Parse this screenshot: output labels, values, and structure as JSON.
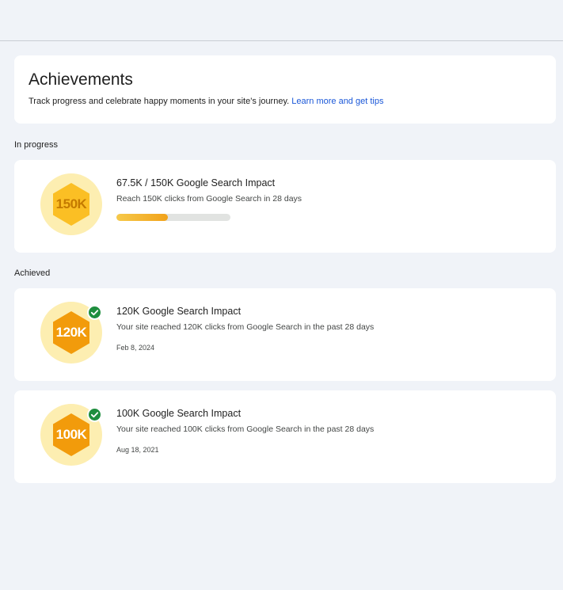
{
  "header": {
    "title": "Achievements",
    "subtitle": "Track progress and celebrate happy moments in your site's journey.",
    "link_label": "Learn more and get tips"
  },
  "sections": {
    "in_progress_label": "In progress",
    "achieved_label": "Achieved"
  },
  "in_progress": [
    {
      "badge": "150K",
      "title": "67.5K / 150K Google Search Impact",
      "description": "Reach 150K clicks from Google Search in 28 days",
      "progress": 0.45
    }
  ],
  "achieved": [
    {
      "badge": "120K",
      "title": "120K Google Search Impact",
      "description": "Your site reached 120K clicks from Google Search in the past 28 days",
      "date": "Feb 8, 2024"
    },
    {
      "badge": "100K",
      "title": "100K Google Search Impact",
      "description": "Your site reached 100K clicks from Google Search in the past 28 days",
      "date": "Aug 18, 2021"
    }
  ],
  "colors": {
    "badge_circle": "#fdeeb1",
    "badge_hex_progress": "#fbbf24",
    "badge_hex_done": "#f29b0b",
    "check_green": "#1e8e3e",
    "link_blue": "#1a57d8"
  },
  "icons": {
    "badge": "hexagon-badge-icon",
    "achieved_mark": "check-circle-icon"
  }
}
